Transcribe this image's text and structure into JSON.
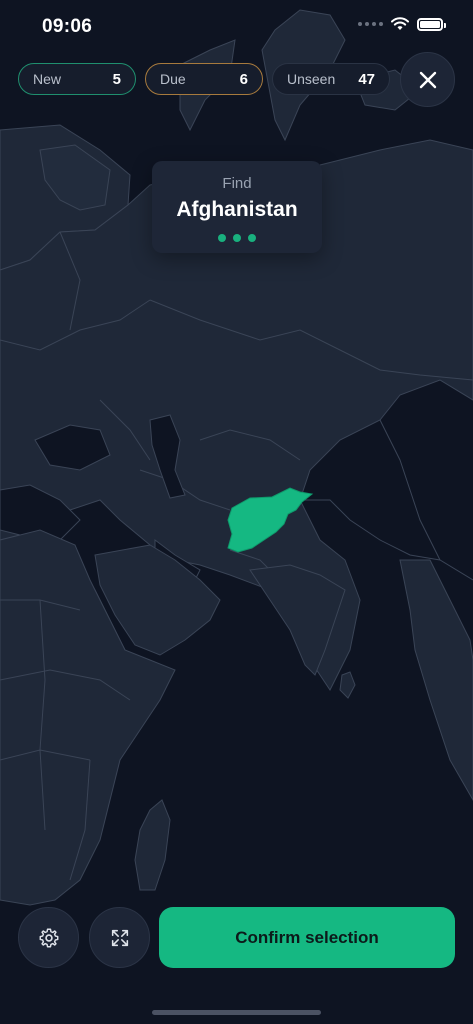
{
  "status_bar": {
    "time": "09:06"
  },
  "counters": [
    {
      "label": "New",
      "count": "5"
    },
    {
      "label": "Due",
      "count": "6"
    },
    {
      "label": "Unseen",
      "count": "47"
    }
  ],
  "prompt": {
    "find_label": "Find",
    "country": "Afghanistan"
  },
  "actions": {
    "confirm_label": "Confirm selection"
  },
  "icons": {
    "close": "close-icon",
    "settings": "gear-icon",
    "fullscreen": "expand-icon",
    "wifi": "wifi-icon",
    "battery": "battery-icon"
  },
  "colors": {
    "background": "#0e1422",
    "land": "#1f2838",
    "border": "#3a4456",
    "highlight": "#15b882",
    "chip_new_border": "#1f8f6e",
    "chip_due_border": "#a77a3d"
  }
}
